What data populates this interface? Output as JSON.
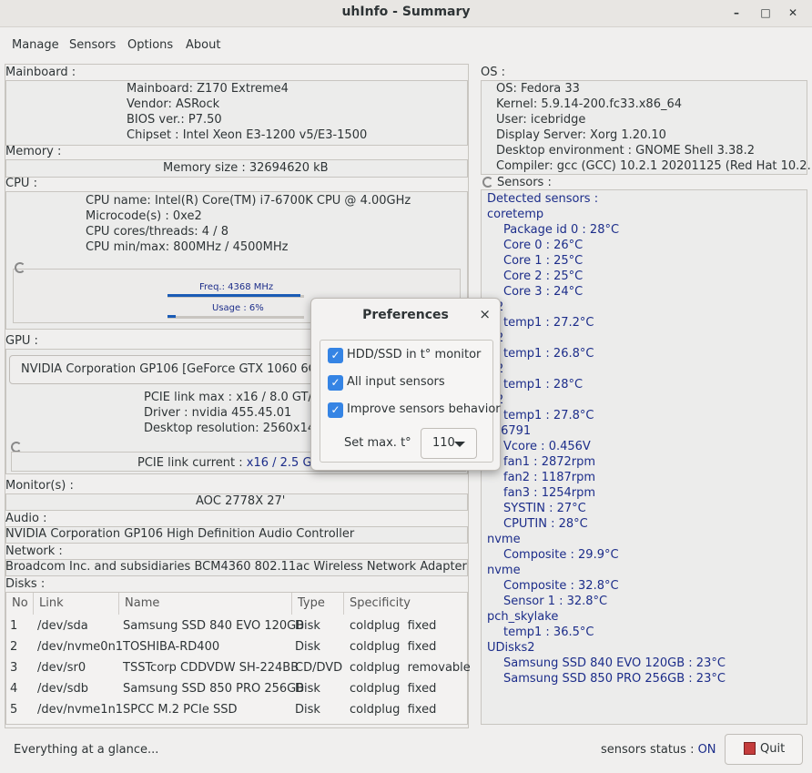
{
  "window": {
    "title": "uhInfo - Summary",
    "minimize": "–",
    "maximize": "□",
    "close": "✕"
  },
  "menu": [
    "Manage",
    "Sensors",
    "Options",
    "About"
  ],
  "mainboard": {
    "label": "Mainboard :",
    "lines": [
      "Mainboard: Z170 Extreme4",
      "Vendor: ASRock",
      "BIOS ver.: P7.50",
      "Chipset : Intel Xeon E3-1200 v5/E3-1500"
    ]
  },
  "memory": {
    "label": "Memory :",
    "size": "Memory size : 32694620 kB"
  },
  "cpu": {
    "label": "CPU :",
    "lines": [
      "CPU name: Intel(R) Core(TM) i7-6700K CPU @ 4.00GHz",
      "Microcode(s) : 0xe2",
      "CPU cores/threads: 4 / 8",
      "CPU min/max: 800MHz / 4500MHz"
    ],
    "freq_label": "Freq.: 4368 MHz",
    "freq_fraction": 0.97,
    "usage_label": "Usage : 6%",
    "usage_fraction": 0.06
  },
  "gpu": {
    "label": "GPU :",
    "selected": "NVIDIA Corporation GP106 [GeForce GTX 1060 6GB]",
    "lines": [
      "PCIE link max : x16 / 8.0 GT/s P",
      "Driver : nvidia  455.45.01",
      "Desktop resolution: 2560x1440"
    ],
    "pcie_current_label": "PCIE link current : ",
    "pcie_current_value": "x16 / 2.5 GT/s"
  },
  "monitors": {
    "label": "Monitor(s) :",
    "value": "AOC 2778X  27'"
  },
  "audio": {
    "label": "Audio :",
    "value": "NVIDIA Corporation GP106 High Definition Audio Controller"
  },
  "network": {
    "label": "Network :",
    "value": "Broadcom Inc. and subsidiaries BCM4360 802.11ac Wireless Network Adapter"
  },
  "disks": {
    "label": "Disks :",
    "headers": [
      "No",
      "Link",
      "Name",
      "Type",
      "Specificity"
    ],
    "rows": [
      [
        "1",
        "/dev/sda",
        "Samsung SSD 840 EVO 120GB",
        "Disk",
        "coldplug  fixed"
      ],
      [
        "2",
        "/dev/nvme0n1",
        "TOSHIBA-RD400",
        "Disk",
        "coldplug  fixed"
      ],
      [
        "3",
        "/dev/sr0",
        "TSSTcorp CDDVDW SH-224BB",
        "CD/DVD",
        "coldplug  removable"
      ],
      [
        "4",
        "/dev/sdb",
        "Samsung SSD 850 PRO 256GB",
        "Disk",
        "coldplug  fixed"
      ],
      [
        "5",
        "/dev/nvme1n1",
        "SPCC M.2 PCIe SSD",
        "Disk",
        "coldplug  fixed"
      ]
    ]
  },
  "os": {
    "label": "OS :",
    "lines": [
      "OS: Fedora 33",
      "Kernel: 5.9.14-200.fc33.x86_64",
      "User: icebridge",
      "Display Server: Xorg 1.20.10",
      "Desktop environment : GNOME Shell 3.38.2",
      "Compiler: gcc (GCC) 10.2.1 20201125 (Red Hat 10.2.1-9)"
    ]
  },
  "sensors": {
    "label": "Sensors :",
    "lines": [
      "Detected sensors :",
      "coretemp",
      "Package id 0 : 28°C",
      "Core 0 : 26°C",
      "Core 1 : 25°C",
      "Core 2 : 25°C",
      "Core 3 : 24°C",
      "2",
      "temp1 : 27.2°C",
      "2",
      "temp1 : 26.8°C",
      "2",
      "temp1 : 28°C",
      "2",
      "temp1 : 27.8°C",
      "t6791",
      "Vcore : 0.456V",
      "fan1 : 2872rpm",
      "fan2 : 1187rpm",
      "fan3 : 1254rpm",
      "SYSTIN : 27°C",
      "CPUTIN : 28°C",
      "nvme",
      "Composite : 29.9°C",
      "nvme",
      "Composite : 32.8°C",
      "Sensor 1 : 32.8°C",
      "pch_skylake",
      "temp1 : 36.5°C",
      "UDisks2",
      "Samsung SSD 840 EVO 120GB : 23°C",
      "Samsung SSD 850 PRO 256GB : 23°C"
    ]
  },
  "status": {
    "message": "Everything at a glance...",
    "sensors_label": "sensors status : ",
    "sensors_value": "ON",
    "quit": "Quit"
  },
  "preferences": {
    "title": "Preferences",
    "close": "×",
    "options": [
      {
        "label": "HDD/SSD in t° monitor",
        "checked": true
      },
      {
        "label": "All input sensors",
        "checked": true
      },
      {
        "label": "Improve sensors behavior",
        "checked": true
      }
    ],
    "max_temp_label": "Set max. t°",
    "max_temp_value": "110",
    "check_glyph": "✓"
  }
}
